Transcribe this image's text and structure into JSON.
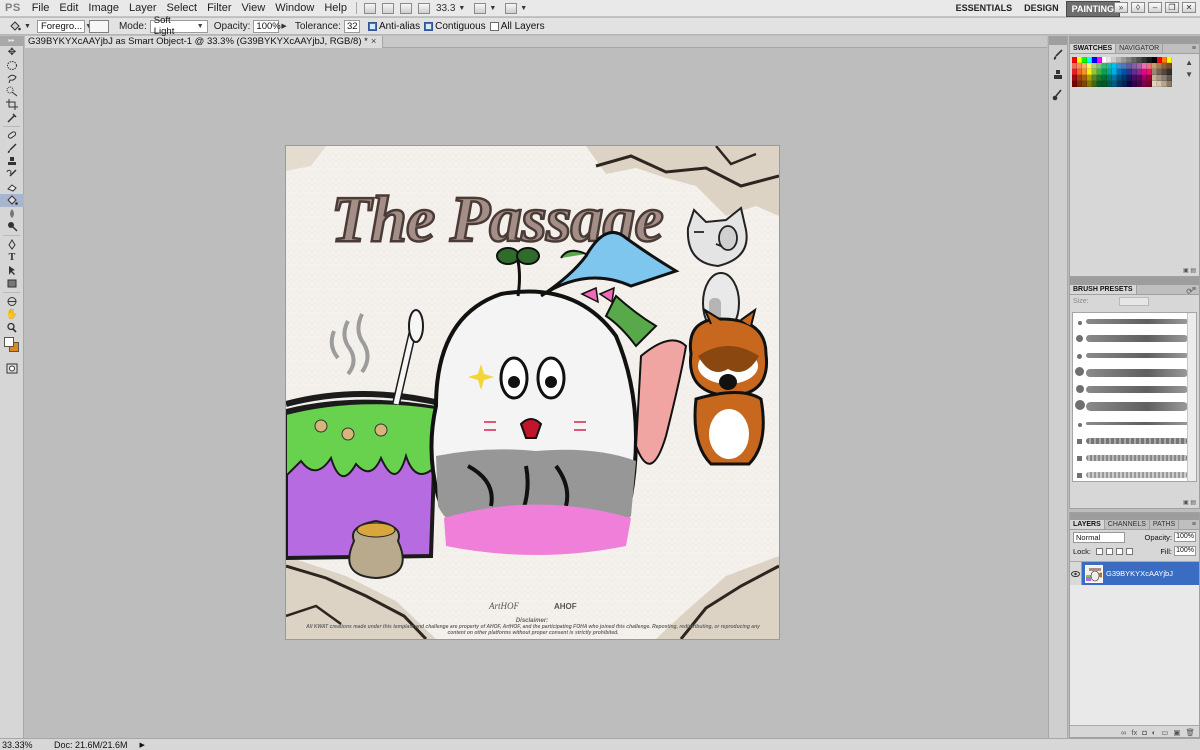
{
  "app": {
    "logo": "PS"
  },
  "menu": [
    "File",
    "Edit",
    "Image",
    "Layer",
    "Select",
    "Filter",
    "View",
    "Window",
    "Help"
  ],
  "menubar_zoom": "33.3",
  "workspaces": [
    "ESSENTIALS",
    "DESIGN",
    "PAINTING"
  ],
  "options": {
    "fill_source": "Foregro...",
    "mode_label": "Mode:",
    "mode_value": "Soft Light",
    "opacity_label": "Opacity:",
    "opacity_value": "100%",
    "tolerance_label": "Tolerance:",
    "tolerance_value": "32",
    "antialias_label": "Anti-alias",
    "contiguous_label": "Contiguous",
    "all_layers_label": "All Layers"
  },
  "document": {
    "tab_title": "G39BYKYXcAAYjbJ as Smart Object-1 @ 33.3% (G39BYKYXcAAYjbJ, RGB/8) *",
    "artwork_title": "The Passage",
    "logo1": "ArtHOF",
    "logo2": "AHOF",
    "disclaimer_head": "Disclaimer:",
    "disclaimer_body": "All KWAT creations made under this template and challenge are property of AHOF, ArtHOF, and the participating FOHA who joined this challenge. Reposting, redistributing, or reproducing any content on other platforms without proper consent is strictly prohibited."
  },
  "status": {
    "zoom": "33.33%",
    "doc": "Doc: 21.6M/21.6M"
  },
  "panels": {
    "swatches_tabs": [
      "SWATCHES",
      "NAVIGATOR"
    ],
    "brush_tab": "BRUSH PRESETS",
    "brush_size_label": "Size:",
    "layers_tabs": [
      "LAYERS",
      "CHANNELS",
      "PATHS"
    ],
    "blend_mode": "Normal",
    "opacity_label": "Opacity:",
    "opacity_value": "100%",
    "lock_label": "Lock:",
    "fill_label": "Fill:",
    "fill_value": "100%",
    "layer_name": "G39BYKYXcAAYjbJ"
  },
  "colors": {
    "accent": "#3a6cc2",
    "foreground": "#ffffff",
    "background": "#dd8a1b",
    "swatches": [
      "#ff0000",
      "#ffff00",
      "#00ff00",
      "#00ffff",
      "#0000ff",
      "#ff00ff",
      "#ffffff",
      "#e6e6e6",
      "#cccccc",
      "#b3b3b3",
      "#999999",
      "#808080",
      "#666666",
      "#4d4d4d",
      "#333333",
      "#1a1a1a",
      "#000000",
      "#ff0000",
      "#ff8000",
      "#ffff00",
      "#f26c4f",
      "#f68e55",
      "#fbaf5d",
      "#fff467",
      "#acd372",
      "#7cc576",
      "#3bb878",
      "#1abbb4",
      "#00bff3",
      "#438ccb",
      "#5574b9",
      "#605ca8",
      "#855fa8",
      "#a763a8",
      "#f06ea9",
      "#f26d7d",
      "#c69c6d",
      "#a67c52",
      "#8c6239",
      "#754c24",
      "#ed1c24",
      "#f26522",
      "#f7941d",
      "#fff200",
      "#8dc63f",
      "#39b54a",
      "#00a651",
      "#00a99d",
      "#00aeef",
      "#0072bc",
      "#0054a6",
      "#2e3192",
      "#662d91",
      "#92278f",
      "#ec008c",
      "#ed145b",
      "#998675",
      "#736357",
      "#534741",
      "#362f2d",
      "#9e0b0f",
      "#a0410d",
      "#a36209",
      "#aba000",
      "#598527",
      "#1a7b30",
      "#007236",
      "#00746b",
      "#0076a3",
      "#004b80",
      "#003471",
      "#1b1464",
      "#440e62",
      "#630460",
      "#9e005d",
      "#9e0039",
      "#c7b299",
      "#a69580",
      "#8a7e6f",
      "#605a52",
      "#790000",
      "#7b2e00",
      "#7d4900",
      "#827b00",
      "#406618",
      "#005e20",
      "#005826",
      "#005952",
      "#005b7f",
      "#003663",
      "#002157",
      "#0d004c",
      "#32004b",
      "#4b0049",
      "#7b0046",
      "#7a0026",
      "#e2d4c1",
      "#d6c6ac",
      "#b8a68a",
      "#8c7b62"
    ]
  }
}
